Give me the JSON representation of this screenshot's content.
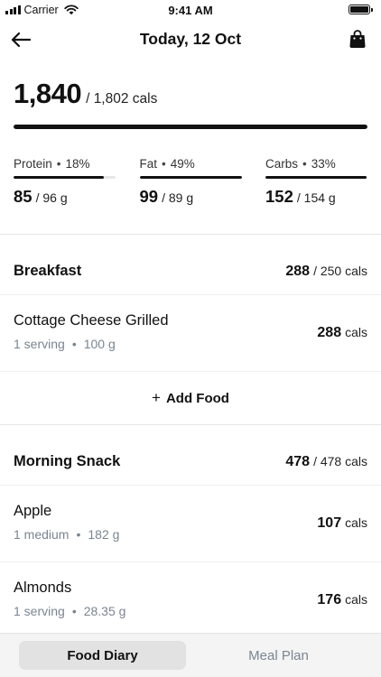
{
  "status_bar": {
    "carrier": "Carrier",
    "time": "9:41 AM"
  },
  "header": {
    "title": "Today, 12 Oct",
    "back_icon": "arrow-left-icon",
    "bag_icon": "shopping-bag-icon"
  },
  "summary": {
    "calories_eaten": "1,840",
    "calories_goal": "/ 1,802 cals",
    "progress_fraction": 1.0
  },
  "macros": [
    {
      "name": "Protein",
      "dot": "•",
      "percent": "18%",
      "amount": "85",
      "goal": "/ 96 g",
      "progress_fraction": 0.885
    },
    {
      "name": "Fat",
      "dot": "•",
      "percent": "49%",
      "amount": "99",
      "goal": "/ 89 g",
      "progress_fraction": 1.0
    },
    {
      "name": "Carbs",
      "dot": "•",
      "percent": "33%",
      "amount": "152",
      "goal": "/ 154 g",
      "progress_fraction": 0.987
    }
  ],
  "meals": [
    {
      "title": "Breakfast",
      "cals": "288",
      "cals_goal": "/ 250 cals",
      "foods": [
        {
          "name": "Cottage Cheese Grilled",
          "serving": "1 serving",
          "dot": "•",
          "weight": "100 g",
          "cals": "288",
          "unit": "cals"
        }
      ],
      "add_food_label": "Add Food",
      "add_food_icon": "+"
    },
    {
      "title": "Morning Snack",
      "cals": "478",
      "cals_goal": "/ 478 cals",
      "foods": [
        {
          "name": "Apple",
          "serving": "1 medium",
          "dot": "•",
          "weight": "182 g",
          "cals": "107",
          "unit": "cals"
        },
        {
          "name": "Almonds",
          "serving": "1 serving",
          "dot": "•",
          "weight": "28.35 g",
          "cals": "176",
          "unit": "cals"
        }
      ]
    }
  ],
  "tabs": [
    {
      "label": "Food Diary",
      "active": true
    },
    {
      "label": "Meal Plan",
      "active": false
    }
  ]
}
